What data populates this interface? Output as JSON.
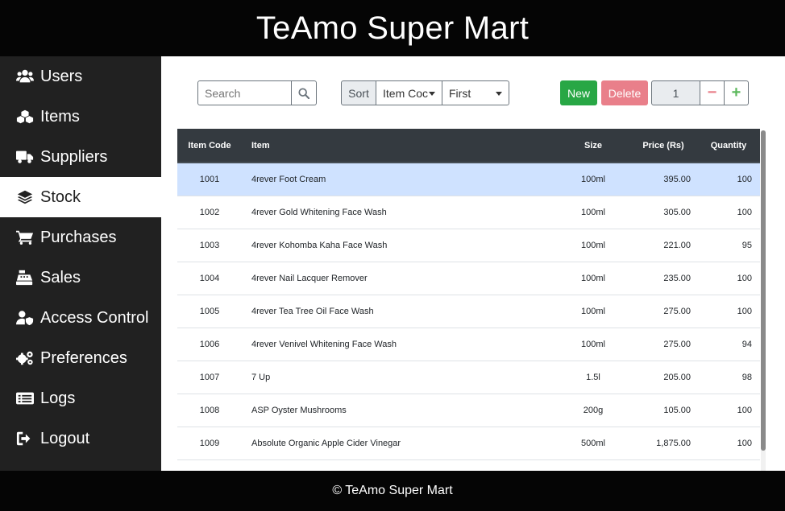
{
  "app": {
    "title": "TeAmo Super Mart",
    "footer": "© TeAmo Super Mart"
  },
  "sidebar": {
    "items": [
      {
        "label": "Users",
        "icon": "users-icon",
        "active": false
      },
      {
        "label": "Items",
        "icon": "boxes-icon",
        "active": false
      },
      {
        "label": "Suppliers",
        "icon": "truck-icon",
        "active": false
      },
      {
        "label": "Stock",
        "icon": "layers-icon",
        "active": true
      },
      {
        "label": "Purchases",
        "icon": "cart-icon",
        "active": false
      },
      {
        "label": "Sales",
        "icon": "cash-register-icon",
        "active": false
      },
      {
        "label": "Access Control",
        "icon": "user-shield-icon",
        "active": false
      },
      {
        "label": "Preferences",
        "icon": "cogs-icon",
        "active": false
      },
      {
        "label": "Logs",
        "icon": "list-icon",
        "active": false
      },
      {
        "label": "Logout",
        "icon": "logout-icon",
        "active": false
      }
    ]
  },
  "toolbar": {
    "search_placeholder": "Search",
    "sort_label": "Sort",
    "sort_key": "Item Coc",
    "sort_order": "First",
    "new_label": "New",
    "delete_label": "Delete",
    "stepper_value": "1",
    "minus_label": "−",
    "plus_label": "+"
  },
  "table": {
    "columns": [
      "Item Code",
      "Item",
      "Size",
      "Price (Rs)",
      "Quantity"
    ],
    "rows": [
      [
        "1001",
        "4rever Foot Cream",
        "100ml",
        "395.00",
        "100"
      ],
      [
        "1002",
        "4rever Gold Whitening Face Wash",
        "100ml",
        "305.00",
        "100"
      ],
      [
        "1003",
        "4rever Kohomba Kaha Face Wash",
        "100ml",
        "221.00",
        "95"
      ],
      [
        "1004",
        "4rever Nail Lacquer Remover",
        "100ml",
        "235.00",
        "100"
      ],
      [
        "1005",
        "4rever Tea Tree Oil Face Wash",
        "100ml",
        "275.00",
        "100"
      ],
      [
        "1006",
        "4rever Venivel Whitening Face Wash",
        "100ml",
        "275.00",
        "94"
      ],
      [
        "1007",
        "7 Up",
        "1.5l",
        "205.00",
        "98"
      ],
      [
        "1008",
        "ASP Oyster Mushrooms",
        "200g",
        "105.00",
        "100"
      ],
      [
        "1009",
        "Absolute Organic Apple Cider Vinegar",
        "500ml",
        "1,875.00",
        "100"
      ]
    ],
    "selected_row": 0
  },
  "colors": {
    "header": "#050505",
    "sidebar": "#212121",
    "new": "#28a745",
    "delete": "#e97f8a",
    "selected_row": "#cfe2ff",
    "table_head": "#343a40"
  }
}
